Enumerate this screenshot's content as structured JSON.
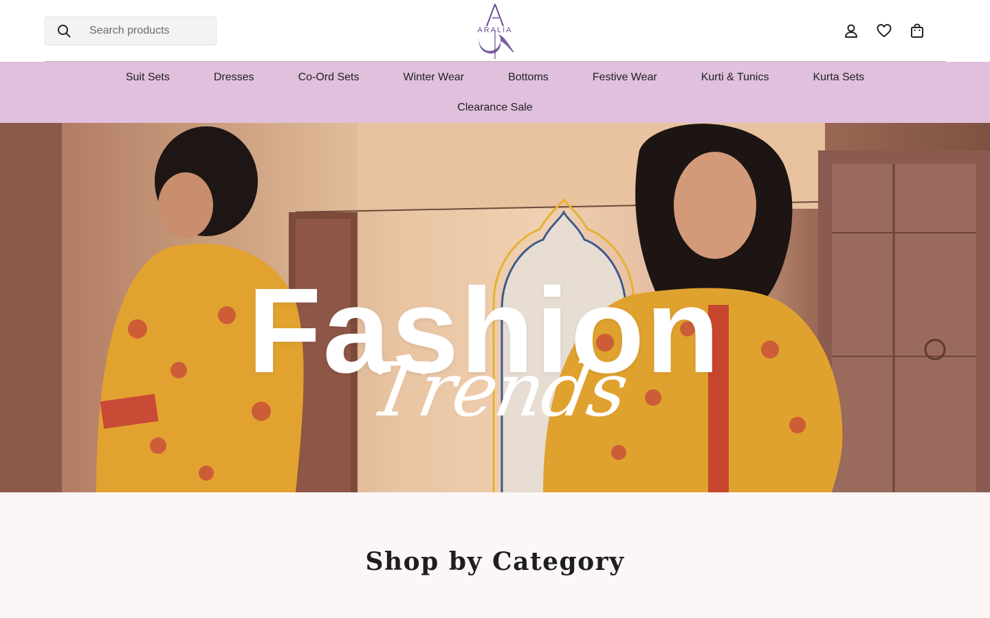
{
  "search": {
    "placeholder": "Search products",
    "value": ""
  },
  "logo": {
    "text": "ARALIA"
  },
  "nav": {
    "row1": [
      "Suit Sets",
      "Dresses",
      "Co-Ord Sets",
      "Winter Wear",
      "Bottoms",
      "Festive Wear",
      "Kurti & Tunics",
      "Kurta Sets"
    ],
    "row2": [
      "Clearance Sale"
    ]
  },
  "hero": {
    "title": "Fashion",
    "subtitle": "Trends"
  },
  "category": {
    "title": "Shop by Category"
  },
  "icons": [
    "search-icon",
    "account-icon",
    "wishlist-heart-icon",
    "shopping-bag-icon"
  ],
  "colors": {
    "nav_bg": "#e0c0dd",
    "brand_purple": "#6b4a93",
    "section_bg": "#fdf6f6"
  }
}
